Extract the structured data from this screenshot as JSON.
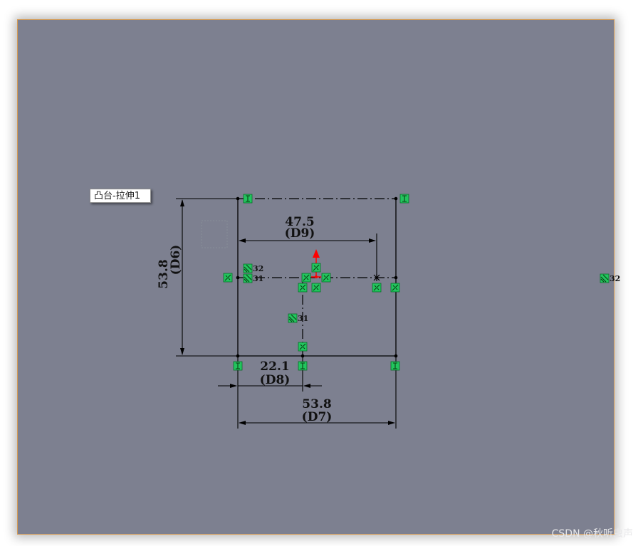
{
  "tooltip": {
    "label": "凸台-拉伸1"
  },
  "dimensions": {
    "d9": {
      "value": "47.5",
      "name": "(D9)"
    },
    "d6": {
      "value": "53.8",
      "name": "(D6)"
    },
    "d8": {
      "value": "22.1",
      "name": "(D8)"
    },
    "d7": {
      "value": "53.8",
      "name": "(D7)"
    }
  },
  "relations": {
    "r32_a": "32",
    "r31_a": "31",
    "r31_b": "31",
    "r32_b": "32"
  },
  "watermark": "CSDN @秋听虫声",
  "colors": {
    "background": "#7d8090",
    "relation_icon": "#22c55e",
    "origin_arrow": "#ff0000",
    "sketch_line": "#000000"
  }
}
